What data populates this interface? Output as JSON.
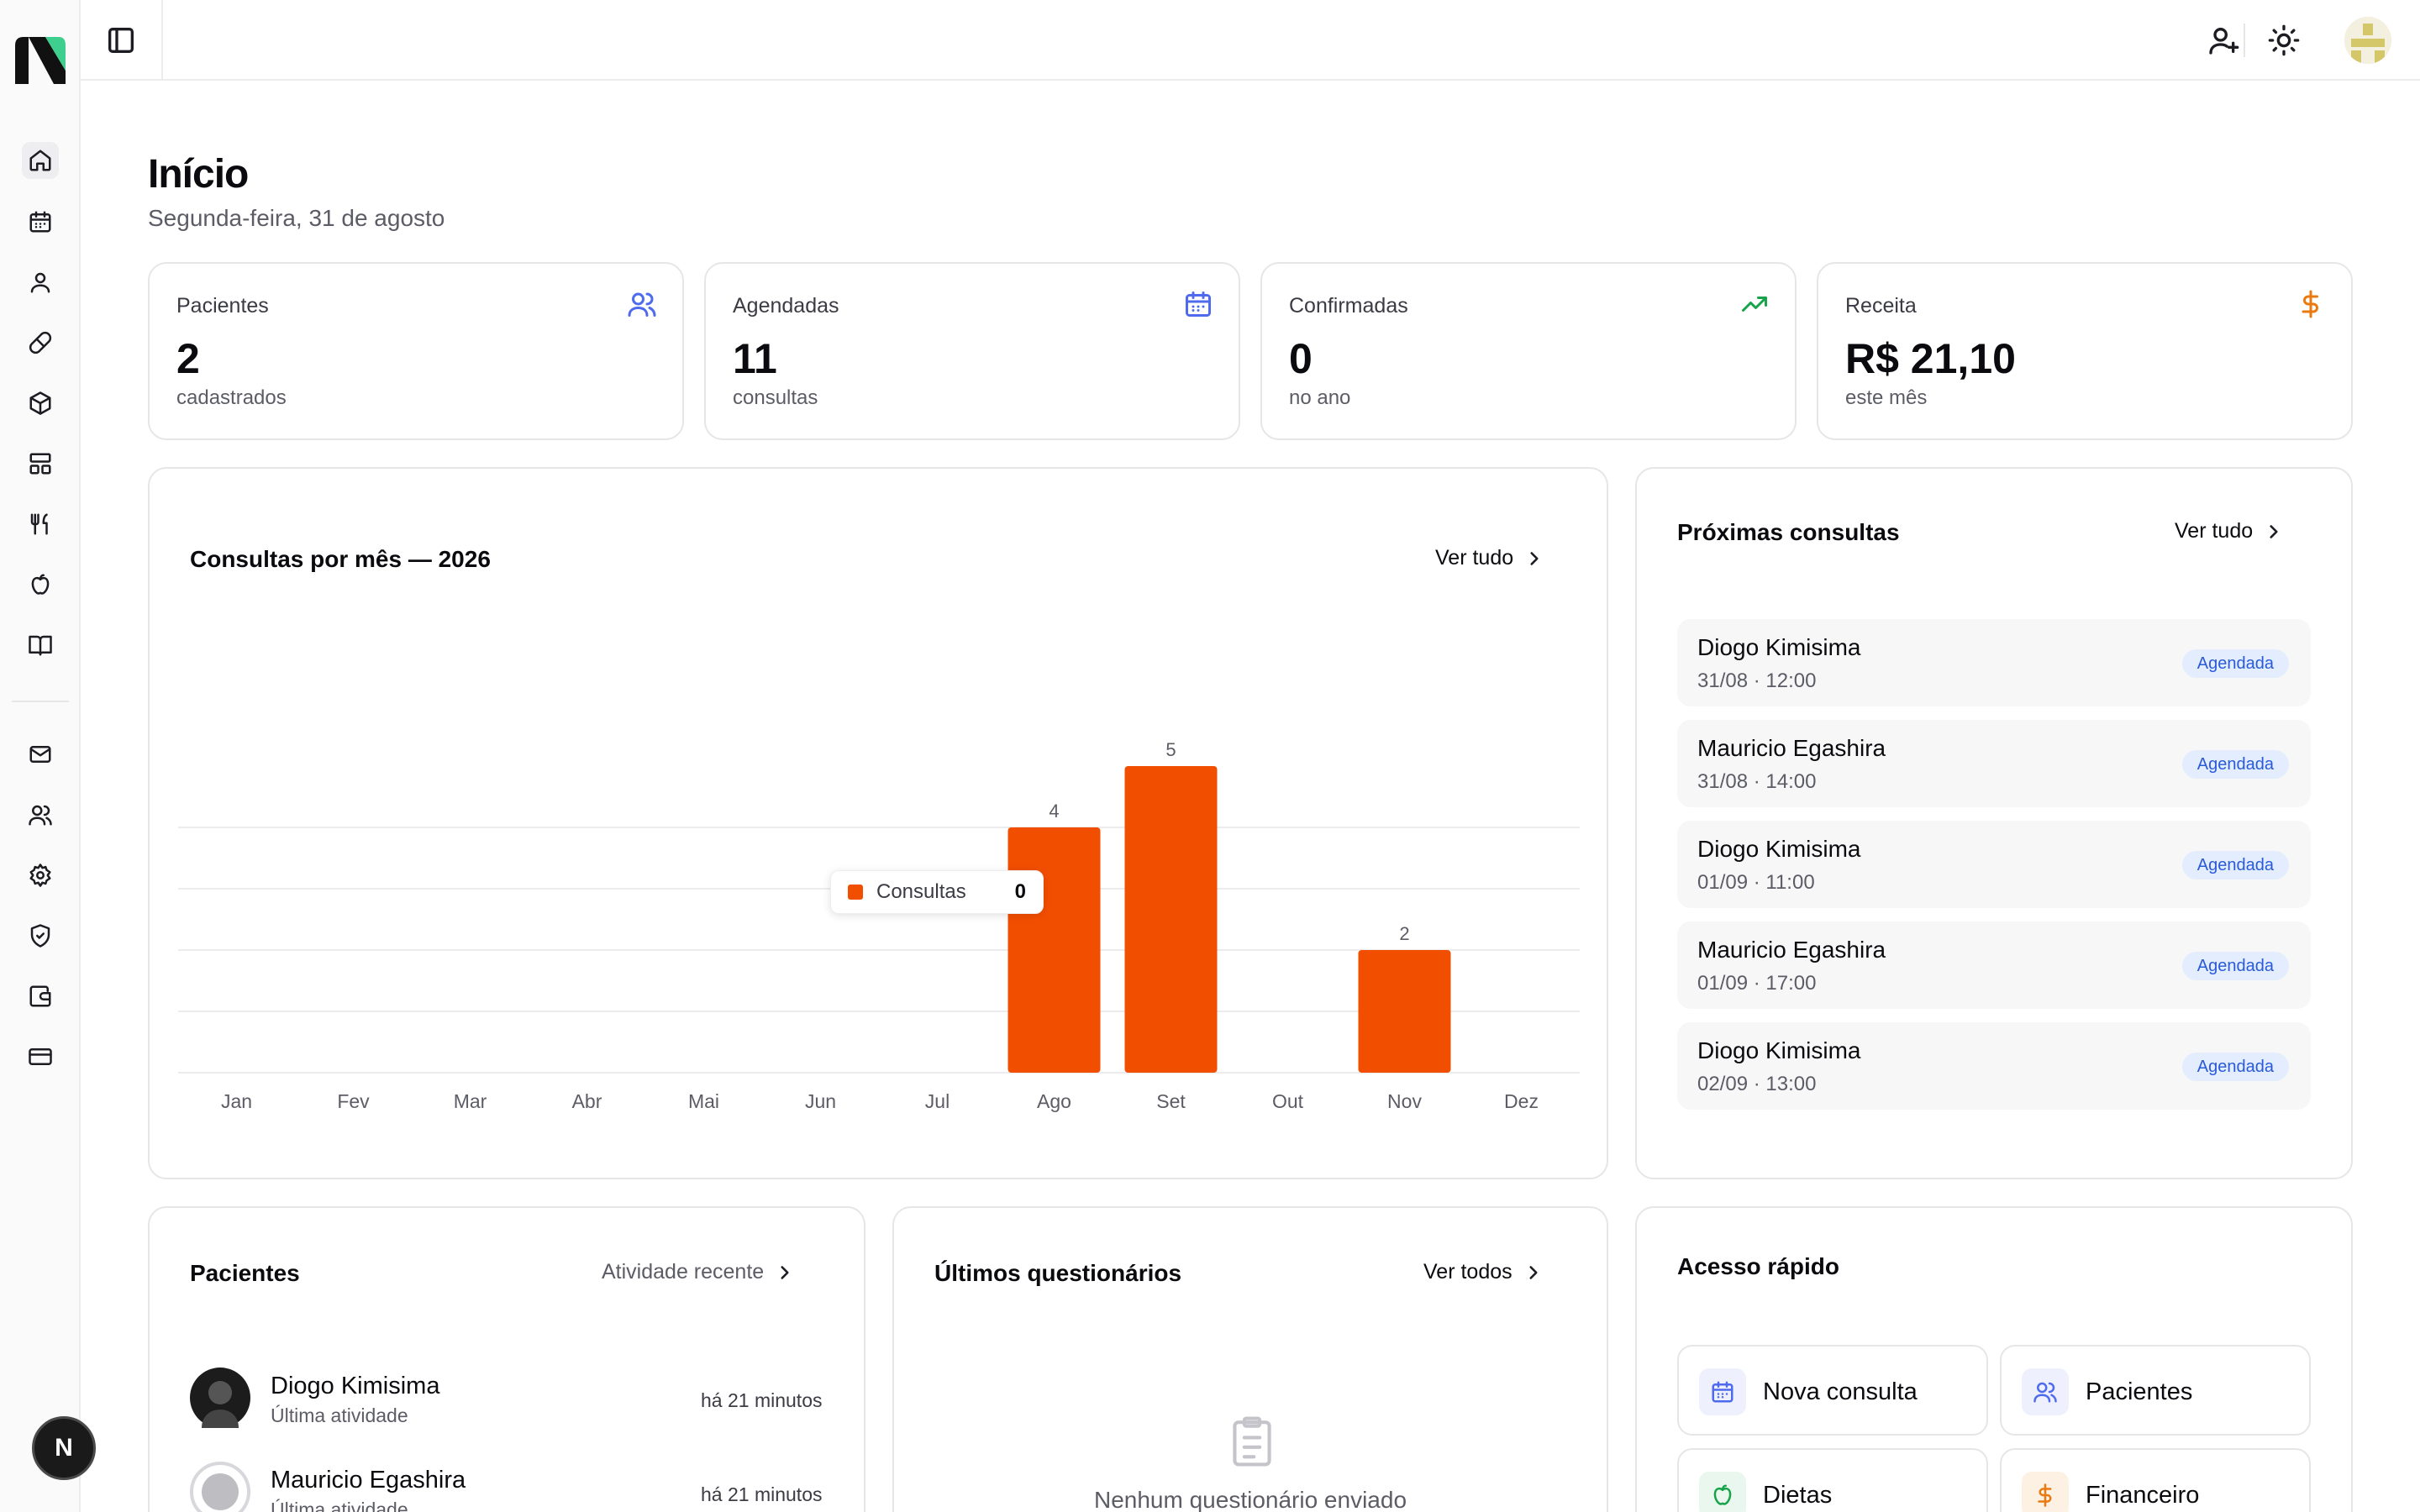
{
  "page": {
    "title": "Início",
    "date": "Segunda-feira, 31 de agosto"
  },
  "sidebar": {
    "items": [
      {
        "icon": "home-icon"
      },
      {
        "icon": "calendar-icon"
      },
      {
        "icon": "user-icon"
      },
      {
        "icon": "pill-icon"
      },
      {
        "icon": "package-icon"
      },
      {
        "icon": "layout-icon"
      },
      {
        "icon": "utensils-icon"
      },
      {
        "icon": "apple-icon"
      },
      {
        "icon": "book-icon"
      },
      {
        "icon": "mail-icon"
      },
      {
        "icon": "users-icon"
      },
      {
        "icon": "settings-icon"
      },
      {
        "icon": "shield-check-icon"
      },
      {
        "icon": "wallet-icon"
      },
      {
        "icon": "credit-card-icon"
      }
    ],
    "bottom_badge": "N"
  },
  "stats": [
    {
      "label": "Pacientes",
      "value": "2",
      "sub": "cadastrados",
      "color": "#4f6bed"
    },
    {
      "label": "Agendadas",
      "value": "11",
      "sub": "consultas",
      "color": "#4f6bed"
    },
    {
      "label": "Confirmadas",
      "value": "0",
      "sub": "no ano",
      "color": "#16a34a"
    },
    {
      "label": "Receita",
      "value": "R$ 21,10",
      "sub": "este mês",
      "color": "#ea7a0f"
    }
  ],
  "chart_card": {
    "title": "Consultas por mês — 2026",
    "link": "Ver tudo"
  },
  "chart_data": {
    "type": "bar",
    "categories": [
      "Jan",
      "Fev",
      "Mar",
      "Abr",
      "Mai",
      "Jun",
      "Jul",
      "Ago",
      "Set",
      "Out",
      "Nov",
      "Dez"
    ],
    "series": [
      {
        "name": "Consultas",
        "values": [
          0,
          0,
          0,
          0,
          0,
          0,
          0,
          4,
          5,
          0,
          2,
          0
        ],
        "color": "#f24e00"
      }
    ],
    "ylim": [
      0,
      8
    ],
    "grid": true
  },
  "tooltip": {
    "name": "Consultas",
    "value": "0"
  },
  "upcoming": {
    "title": "Próximas consultas",
    "link": "Ver tudo",
    "items": [
      {
        "name": "Diogo Kimisima",
        "time": "31/08 · 12:00",
        "status": "Agendada"
      },
      {
        "name": "Mauricio Egashira",
        "time": "31/08 · 14:00",
        "status": "Agendada"
      },
      {
        "name": "Diogo Kimisima",
        "time": "01/09 · 11:00",
        "status": "Agendada"
      },
      {
        "name": "Mauricio Egashira",
        "time": "01/09 · 17:00",
        "status": "Agendada"
      },
      {
        "name": "Diogo Kimisima",
        "time": "02/09 · 13:00",
        "status": "Agendada"
      }
    ]
  },
  "patients": {
    "title": "Pacientes",
    "link": "Atividade recente",
    "items": [
      {
        "name": "Diogo Kimisima",
        "sub": "Última atividade",
        "time": "há 21 minutos"
      },
      {
        "name": "Mauricio Egashira",
        "sub": "Última atividade",
        "time": "há 21 minutos"
      }
    ]
  },
  "questionnaires": {
    "title": "Últimos questionários",
    "link": "Ver todos",
    "empty": "Nenhum questionário enviado"
  },
  "quick_access": {
    "title": "Acesso rápido",
    "items": [
      {
        "label": "Nova consulta",
        "icon": "calendar-icon",
        "color": "#4f6bed",
        "bg": "#eef1fd"
      },
      {
        "label": "Pacientes",
        "icon": "users-icon",
        "color": "#4f6bed",
        "bg": "#eef1fd"
      },
      {
        "label": "Dietas",
        "icon": "apple-icon",
        "color": "#16a34a",
        "bg": "#eaf7ee"
      },
      {
        "label": "Financeiro",
        "icon": "dollar-icon",
        "color": "#ea7a0f",
        "bg": "#fdf1e4"
      }
    ]
  }
}
